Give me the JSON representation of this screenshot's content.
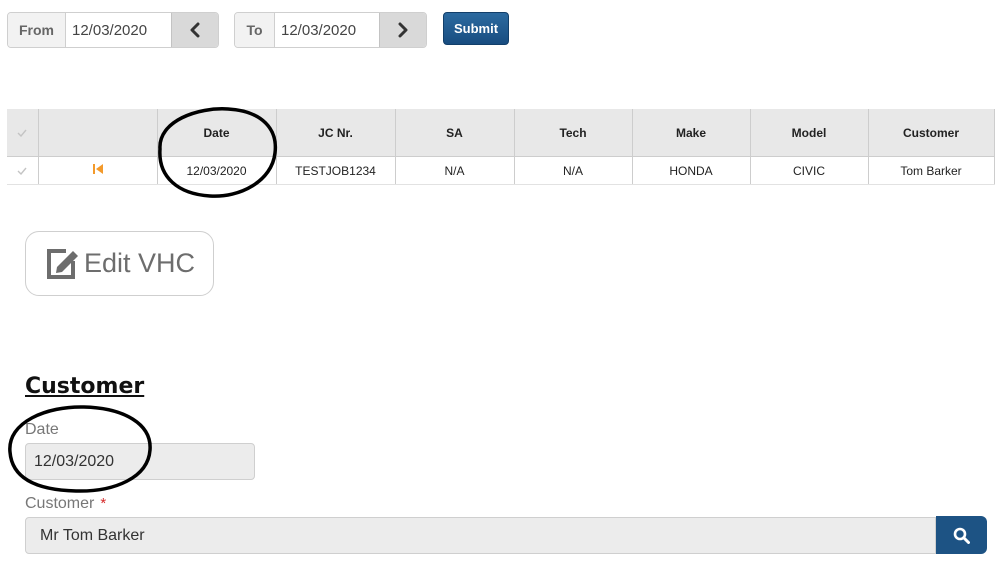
{
  "range": {
    "from_label": "From",
    "from_value": "12/03/2020",
    "to_label": "To",
    "to_value": "12/03/2020",
    "submit_label": "Submit"
  },
  "grid": {
    "columns": [
      "",
      "",
      "Date",
      "JC Nr.",
      "SA",
      "Tech",
      "Make",
      "Model",
      "Customer"
    ],
    "rows": [
      {
        "date": "12/03/2020",
        "jc_nr": "TESTJOB1234",
        "sa": "N/A",
        "tech": "N/A",
        "make": "HONDA",
        "model": "CIVIC",
        "customer": "Tom Barker"
      }
    ],
    "flag_color": "#f39a2b"
  },
  "edit_vhc": {
    "label": "Edit VHC"
  },
  "customer_section": {
    "title": "Customer",
    "date_label": "Date",
    "date_value": "12/03/2020",
    "customer_label": "Customer",
    "required_mark": "*",
    "customer_value": "Mr Tom Barker"
  },
  "colors": {
    "primary_button": "#1d5384",
    "required": "#d62b2b"
  }
}
